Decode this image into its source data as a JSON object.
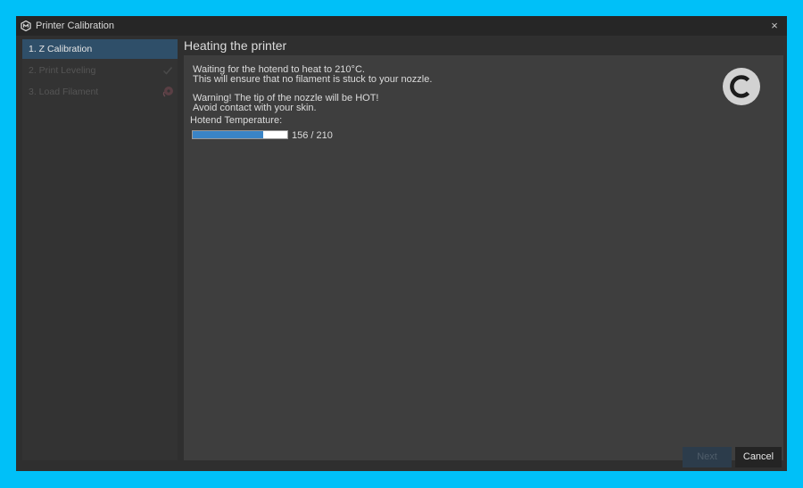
{
  "window": {
    "title": "Printer Calibration",
    "close_glyph": "×"
  },
  "sidebar": {
    "steps": [
      {
        "label": "1. Z Calibration",
        "state": "active"
      },
      {
        "label": "2. Print Leveling",
        "state": "done",
        "icon": "check-icon"
      },
      {
        "label": "3. Load Filament",
        "state": "pending",
        "icon": "filament-spool-icon"
      }
    ]
  },
  "content": {
    "title": "Heating the printer",
    "line1": "Waiting for the hotend to heat to 210°C.",
    "line2": "This will ensure that no filament is stuck to your nozzle.",
    "warning1": "Warning! The tip of the nozzle will be HOT!",
    "warning2": "Avoid contact with your skin.",
    "temp_label": "Hotend Temperature:",
    "temp_current": 156,
    "temp_target": 210,
    "temp_text": "156 / 210",
    "logo_icon": "brand-c-logo-icon"
  },
  "footer": {
    "next_label": "Next",
    "cancel_label": "Cancel"
  },
  "colors": {
    "background": "#00c0f8",
    "accent": "#3a84c6",
    "active_step": "#2f4f69"
  }
}
